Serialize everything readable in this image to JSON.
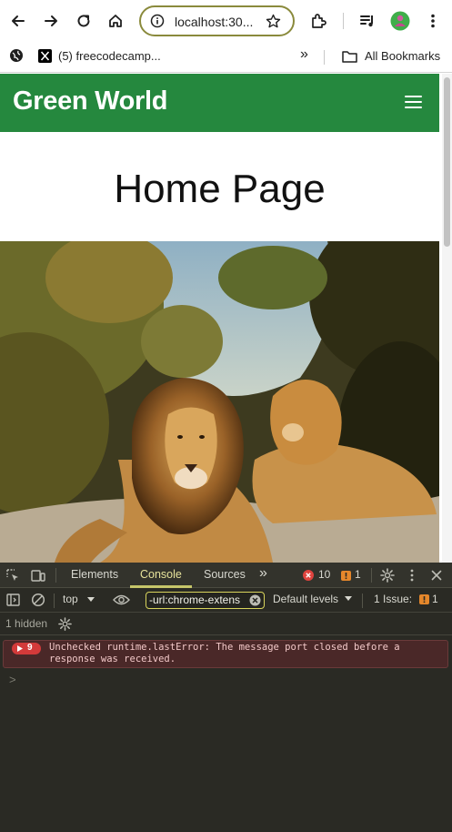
{
  "browser": {
    "url": "localhost:30...",
    "bookmarks": {
      "item1_label": "(5) freecodecamp...",
      "overflow": "»",
      "all_bookmarks": "All Bookmarks"
    }
  },
  "page": {
    "brand": "Green World",
    "title": "Home Page",
    "hero_alt": "Two lions resting on a rock"
  },
  "devtools": {
    "tabs": [
      "Elements",
      "Console",
      "Sources"
    ],
    "active_tab": "Console",
    "more_tabs": "»",
    "error_count": "10",
    "warning_count": "1",
    "context": "top",
    "filter_value": "-url:chrome-extens",
    "levels": "Default levels",
    "issues_label": "1 Issue:",
    "issues_count": "1",
    "hidden_label": "1 hidden",
    "messages": [
      {
        "count": "9",
        "text": "Unchecked runtime.lastError: The message port closed before a response was received."
      }
    ],
    "prompt": ">"
  },
  "colors": {
    "navbar": "#25883e",
    "devtools_bg": "#2a2a24",
    "error_bg": "#4a2828",
    "accent": "#e7e39b"
  }
}
